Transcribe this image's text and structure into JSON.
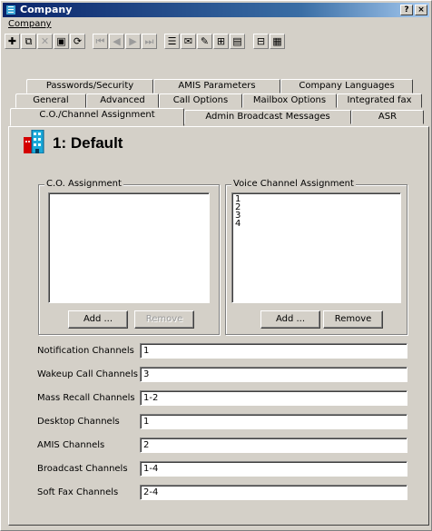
{
  "window": {
    "title": "Company",
    "help_btn": "?",
    "close_btn": "×"
  },
  "menu": {
    "items": [
      "Company"
    ]
  },
  "toolbar": {
    "buttons": [
      {
        "name": "add-icon",
        "glyph": "✚",
        "disabled": false
      },
      {
        "name": "copy-icon",
        "glyph": "⧉",
        "disabled": false
      },
      {
        "name": "delete-icon",
        "glyph": "✕",
        "disabled": true
      },
      {
        "name": "save-icon",
        "glyph": "▣",
        "disabled": false
      },
      {
        "name": "refresh-icon",
        "glyph": "⟳",
        "disabled": false
      },
      {
        "name": "first-record-icon",
        "glyph": "⏮",
        "disabled": true
      },
      {
        "name": "previous-record-icon",
        "glyph": "◀",
        "disabled": true
      },
      {
        "name": "next-record-icon",
        "glyph": "▶",
        "disabled": true
      },
      {
        "name": "last-record-icon",
        "glyph": "⏭",
        "disabled": true
      },
      {
        "name": "list-icon",
        "glyph": "☰",
        "disabled": false
      },
      {
        "name": "mail-icon",
        "glyph": "✉",
        "disabled": false
      },
      {
        "name": "edit-icon",
        "glyph": "✎",
        "disabled": false
      },
      {
        "name": "properties-icon",
        "glyph": "⊞",
        "disabled": false
      },
      {
        "name": "form-icon",
        "glyph": "▤",
        "disabled": false
      },
      {
        "name": "report-icon",
        "glyph": "⊟",
        "disabled": false
      },
      {
        "name": "grid-icon",
        "glyph": "▦",
        "disabled": false
      }
    ]
  },
  "tabs": {
    "row1": [
      "Passwords/Security",
      "AMIS Parameters",
      "Company Languages"
    ],
    "row2": [
      "General",
      "Advanced",
      "Call Options",
      "Mailbox Options",
      "Integrated fax"
    ],
    "row3": [
      "C.O./Channel Assignment",
      "Admin Broadcast Messages",
      "ASR"
    ],
    "active": "C.O./Channel Assignment"
  },
  "heading": "1: Default",
  "co_group": {
    "label": "C.O. Assignment",
    "items": [],
    "add": "Add ...",
    "remove": "Remove"
  },
  "voice_group": {
    "label": "Voice Channel Assignment",
    "items": [
      "1",
      "2",
      "3",
      "4"
    ],
    "add": "Add ...",
    "remove": "Remove"
  },
  "fields": [
    {
      "label": "Notification Channels",
      "value": "1"
    },
    {
      "label": "Wakeup Call Channels",
      "value": "3"
    },
    {
      "label": "Mass Recall Channels",
      "value": "1-2"
    },
    {
      "label": "Desktop Channels",
      "value": "1"
    },
    {
      "label": "AMIS Channels",
      "value": "2"
    },
    {
      "label": "Broadcast Channels",
      "value": "1-4"
    },
    {
      "label": "Soft Fax Channels",
      "value": "2-4"
    }
  ]
}
